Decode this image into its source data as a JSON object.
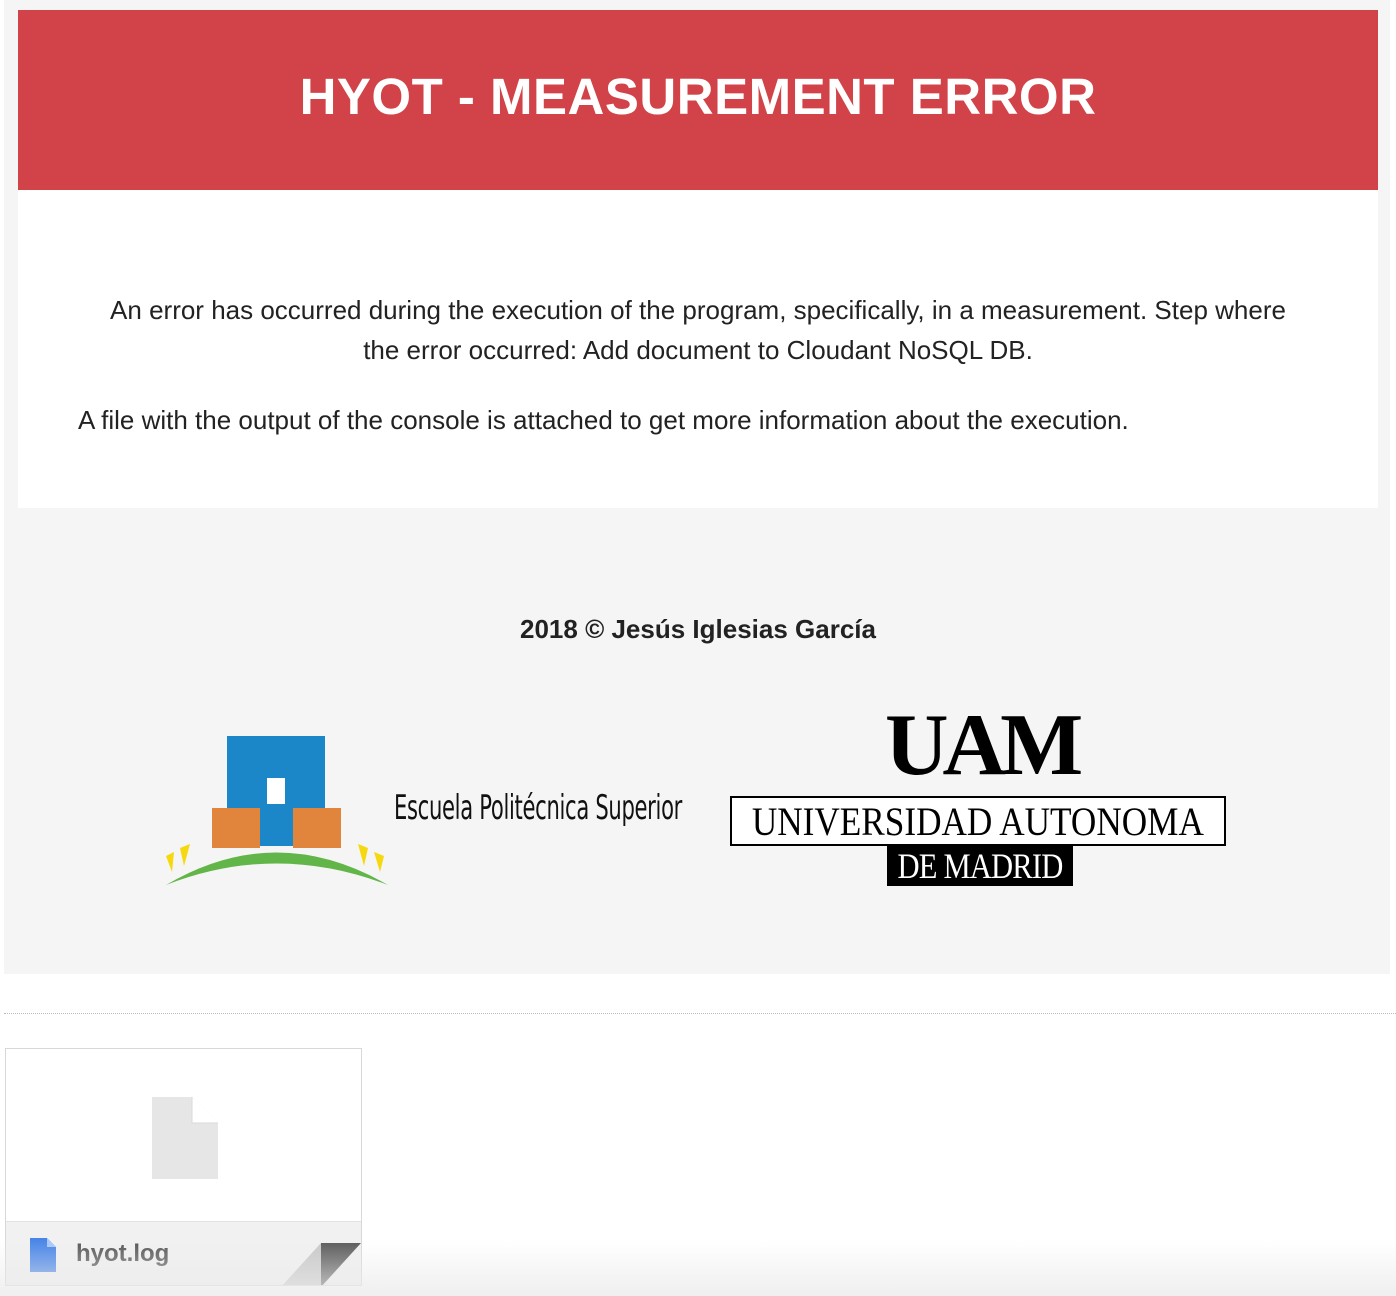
{
  "header": {
    "title": "HYOT - MEASUREMENT ERROR"
  },
  "body": {
    "error_message": "An error has occurred during the execution of the program, specifically, in a measurement. Step where the error occurred: Add document to Cloudant NoSQL DB.",
    "info_message": "A file with the output of the console is attached to get more information about the execution."
  },
  "footer": {
    "copyright": "2018 © Jesús Iglesias García",
    "eps_logo_text": "Escuela Politécnica Superior",
    "uam_logo_letters": "UAM",
    "uam_logo_university": "UNIVERSIDAD  AUTONOMA",
    "uam_logo_city": "DE MADRID"
  },
  "attachment": {
    "filename": "hyot.log",
    "icon": "document-icon"
  },
  "colors": {
    "header_red": "#d14348",
    "card_gray": "#f5f5f5",
    "eps_blue": "#1b87c9",
    "eps_orange": "#e0853b",
    "eps_green": "#62b548",
    "eps_yellow": "#f5d90e",
    "file_blue": "#4a86e8"
  }
}
